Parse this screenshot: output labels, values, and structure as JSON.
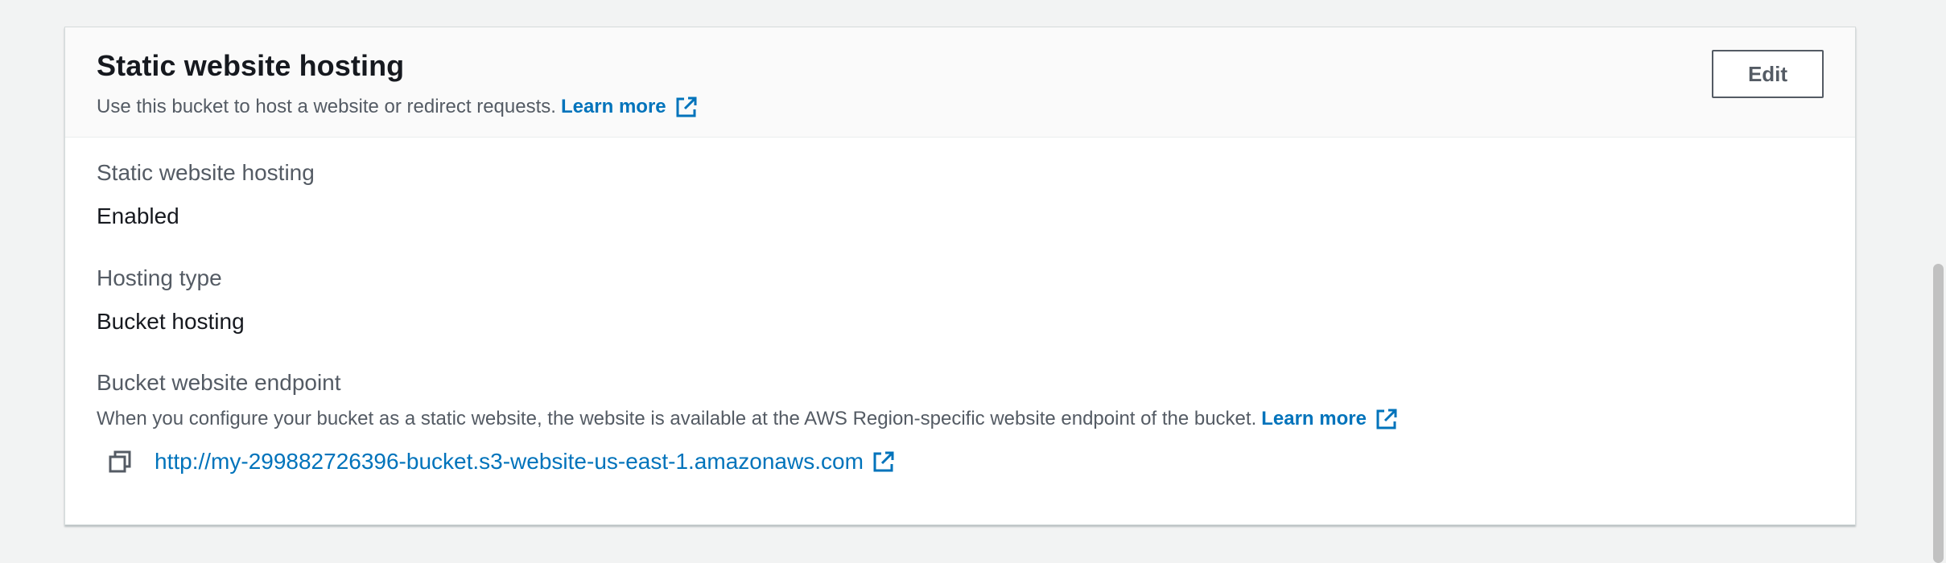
{
  "section": {
    "title": "Static website hosting",
    "description": "Use this bucket to host a website or redirect requests.",
    "learn_more": "Learn more",
    "edit_label": "Edit"
  },
  "fields": {
    "hosting": {
      "label": "Static website hosting",
      "value": "Enabled"
    },
    "hosting_type": {
      "label": "Hosting type",
      "value": "Bucket hosting"
    },
    "endpoint": {
      "label": "Bucket website endpoint",
      "description": "When you configure your bucket as a static website, the website is available at the AWS Region-specific website endpoint of the bucket.",
      "learn_more": "Learn more",
      "url": "http://my-299882726396-bucket.s3-website-us-east-1.amazonaws.com"
    }
  },
  "icons": {
    "external_link": "external-link-icon",
    "copy": "copy-icon"
  },
  "colors": {
    "link": "#0073bb",
    "text_primary": "#16191f",
    "text_secondary": "#545b64",
    "page_background": "#f2f3f3"
  }
}
